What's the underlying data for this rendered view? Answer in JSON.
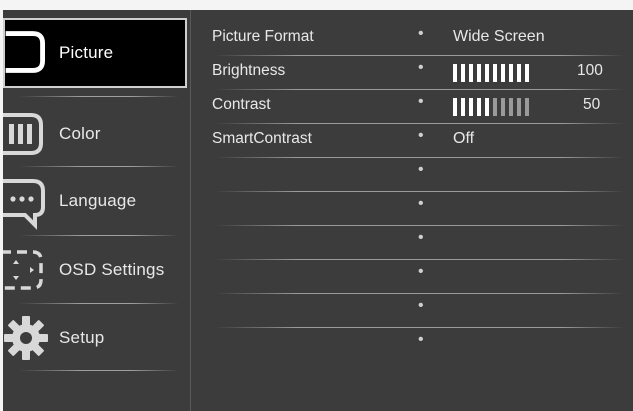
{
  "menu": {
    "items": [
      {
        "label": "Picture",
        "icon": "picture-icon",
        "selected": true
      },
      {
        "label": "Color",
        "icon": "color-icon",
        "selected": false
      },
      {
        "label": "Language",
        "icon": "language-icon",
        "selected": false
      },
      {
        "label": "OSD Settings",
        "icon": "osd-settings-icon",
        "selected": false
      },
      {
        "label": "Setup",
        "icon": "gear-icon",
        "selected": false
      }
    ]
  },
  "settings": {
    "rows": [
      {
        "name": "Picture  Format",
        "value": "Wide Screen"
      },
      {
        "name": "Brightness",
        "level": 1.0,
        "value": "100"
      },
      {
        "name": "Contrast",
        "level": 0.5,
        "value": "50"
      },
      {
        "name": "SmartContrast",
        "value": "Off"
      },
      {
        "name": "",
        "value": ""
      },
      {
        "name": "",
        "value": ""
      },
      {
        "name": "",
        "value": ""
      },
      {
        "name": "",
        "value": ""
      },
      {
        "name": "",
        "value": ""
      },
      {
        "name": "",
        "value": ""
      }
    ],
    "separator_glyph": "•"
  },
  "colors": {
    "background": "#3c3c3c",
    "selected_background": "#000000",
    "text": "#e8e8e8",
    "bar_on": "#ffffff",
    "bar_off": "#9a9a9a"
  }
}
